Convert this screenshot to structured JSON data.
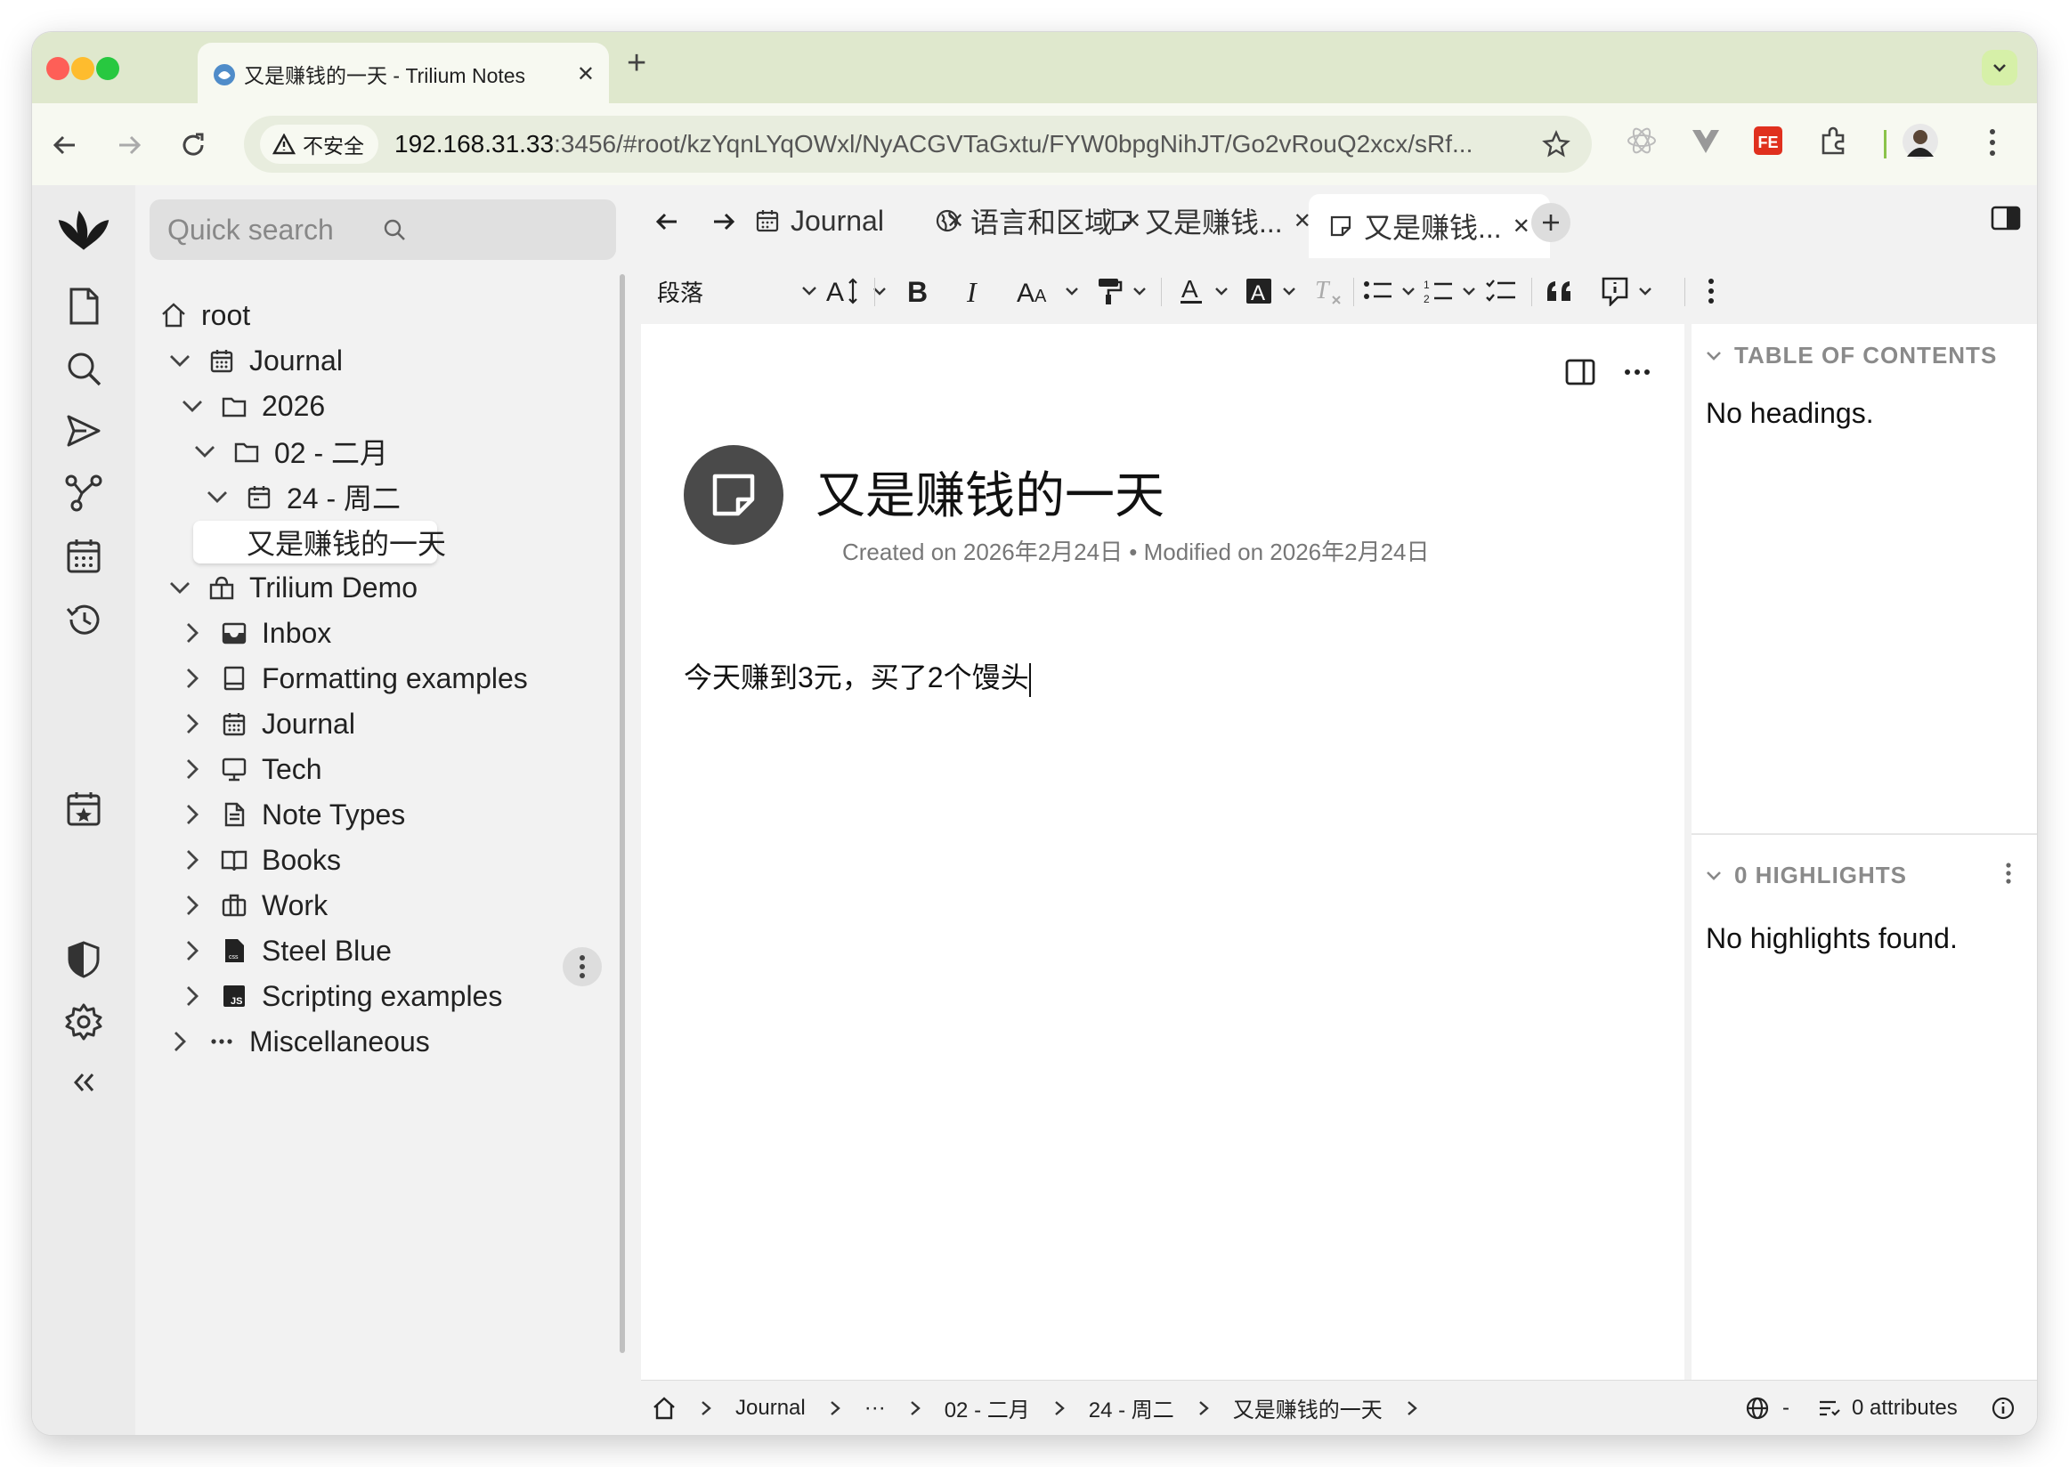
{
  "browser": {
    "tab_title": "又是赚钱的一天 - Trilium Notes",
    "security_label": "不安全",
    "url_host": "192.168.31.33",
    "url_rest": ":3456/#root/kzYqnLYqOWxl/NyACGVTaGxtu/FYW0bpgNihJT/Go2vRouQ2xcx/sRf...",
    "new_tab": "+"
  },
  "sidebar": {
    "search_placeholder": "Quick search",
    "tree": [
      {
        "label": "root",
        "icon": "home-icon"
      },
      {
        "label": "Journal",
        "icon": "calendar-icon"
      },
      {
        "label": "2026",
        "icon": "folder-icon"
      },
      {
        "label": "02 - 二月",
        "icon": "folder-icon"
      },
      {
        "label": "24 - 周二",
        "icon": "calendar-day-icon"
      },
      {
        "label": "又是赚钱的一天",
        "icon": "note-icon"
      },
      {
        "label": "Trilium Demo",
        "icon": "book-open-icon"
      },
      {
        "label": "Inbox",
        "icon": "inbox-icon"
      },
      {
        "label": "Formatting examples",
        "icon": "book-icon"
      },
      {
        "label": "Journal",
        "icon": "calendar-icon"
      },
      {
        "label": "Tech",
        "icon": "monitor-icon"
      },
      {
        "label": "Note Types",
        "icon": "file-text-icon"
      },
      {
        "label": "Books",
        "icon": "open-book-icon"
      },
      {
        "label": "Work",
        "icon": "briefcase-icon"
      },
      {
        "label": "Steel Blue",
        "icon": "css-file-icon"
      },
      {
        "label": "Scripting examples",
        "icon": "js-file-icon"
      },
      {
        "label": "Miscellaneous",
        "icon": "dots-icon"
      }
    ]
  },
  "note_tabs": [
    {
      "label": "Journal",
      "icon": "calendar-icon"
    },
    {
      "label": "语言和区域",
      "icon": "globe-icon"
    },
    {
      "label": "又是赚钱...",
      "icon": "note-icon"
    },
    {
      "label": "又是赚钱...",
      "icon": "note-icon",
      "active": true
    }
  ],
  "editor_toolbar": {
    "paragraph_style": "段落"
  },
  "note": {
    "title": "又是赚钱的一天",
    "meta": "Created on 2026年2月24日 • Modified on 2026年2月24日",
    "body": "今天赚到3元，买了2个馒头"
  },
  "right_panel": {
    "toc_title": "TABLE OF CONTENTS",
    "toc_empty": "No headings.",
    "highlights_title": "0 HIGHLIGHTS",
    "highlights_empty": "No highlights found."
  },
  "status_bar": {
    "breadcrumbs": [
      "Journal",
      "···",
      "02 - 二月",
      "24 - 周二",
      "又是赚钱的一天"
    ],
    "language": "-",
    "attributes": "0 attributes"
  },
  "colors": {
    "tabstrip": "#dfe8cd",
    "toolbar": "#f7f9f1",
    "panel": "#f2f2f2",
    "note_icon_bg": "#4a4a4a"
  }
}
